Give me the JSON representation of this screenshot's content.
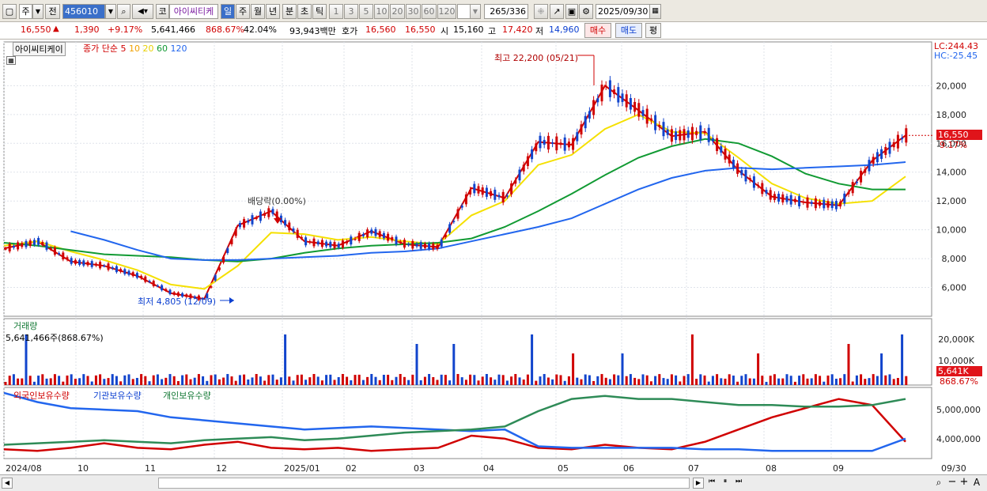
{
  "toolbar": {
    "market": "주",
    "prev_label": "전",
    "code": "456010",
    "name_prefix": "코",
    "name": "아이씨티케",
    "periods": [
      "일",
      "주",
      "월",
      "년",
      "분",
      "초",
      "틱"
    ],
    "period_selected": "일",
    "intervals": [
      "1",
      "3",
      "5",
      "10",
      "20",
      "30",
      "60",
      "120"
    ],
    "count": "265",
    "count_total": "/336",
    "date": "2025/09/30"
  },
  "info": {
    "price": "16,550",
    "change": "1,390",
    "change_pct": "+9.17%",
    "volume": "5,641,466",
    "volume_ratio": "868.67%",
    "turnover": "42.04%",
    "amount": "93,943백만",
    "bid_label": "호가",
    "bid1": "16,560",
    "bid2": "16,550",
    "open_label": "시",
    "open": "15,160",
    "high_label": "고",
    "high": "17,420",
    "low_label": "저",
    "low": "14,960",
    "buy_label": "매수",
    "sell_label": "매도",
    "eval_label": "평"
  },
  "price_panel": {
    "title": "아이씨티케이",
    "legend": "종가 단순",
    "ma": [
      {
        "label": "5",
        "color": "#d00000"
      },
      {
        "label": "10",
        "color": "#f0a000"
      },
      {
        "label": "20",
        "color": "#f5e000"
      },
      {
        "label": "60",
        "color": "#119a33"
      },
      {
        "label": "120",
        "color": "#2266ee"
      }
    ],
    "lc": "LC:244.43",
    "hc": "HC:-25.45",
    "annotations": {
      "high": "최고 22,200 (05/21)",
      "low": "최저 4,805 (12/09)",
      "dividend": "배당락(0.00%)"
    },
    "current_price_tag": "16,550",
    "current_pct_tag": "9.17%"
  },
  "volume_panel": {
    "title": "거래량",
    "value": "5,641,466주(868.67%)",
    "tag1": "5,641K",
    "tag2": "868.67%"
  },
  "holding_panel": {
    "legend": [
      "외국인보유수량",
      "기관보유수량",
      "개인보유수량"
    ]
  },
  "x_axis": [
    "2024/08",
    "10",
    "11",
    "12",
    "2025/01",
    "02",
    "03",
    "04",
    "05",
    "06",
    "07",
    "08",
    "09",
    "09/30"
  ],
  "chart_data": {
    "type": "line",
    "title": "아이씨티케이",
    "y_ticks": [
      6000,
      8000,
      10000,
      12000,
      14000,
      16000,
      18000,
      20000
    ],
    "volume_ticks": [
      "10,000K",
      "20,000K"
    ],
    "holding_ticks": [
      "4,000,000",
      "5,000,000"
    ],
    "x_labels": [
      "2024/08",
      "10",
      "11",
      "12",
      "2025/01",
      "02",
      "03",
      "04",
      "05",
      "06",
      "07",
      "08",
      "09"
    ],
    "series": [
      {
        "name": "5",
        "values": [
          8700,
          9200,
          7800,
          7500,
          6800,
          5600,
          5200,
          10300,
          11300,
          9200,
          8900,
          9900,
          9000,
          8800,
          12900,
          12200,
          16100,
          15900,
          20000,
          18300,
          16500,
          16800,
          14100,
          12300,
          11900,
          11700,
          14800,
          16550
        ]
      },
      {
        "name": "20",
        "values": [
          8900,
          9200,
          8500,
          7900,
          7200,
          6200,
          5900,
          7500,
          9800,
          9700,
          9300,
          9500,
          9200,
          9000,
          11000,
          12000,
          14500,
          15200,
          17000,
          18000,
          16800,
          16700,
          15000,
          13200,
          12200,
          11800,
          12000,
          13700
        ]
      },
      {
        "name": "60",
        "values": [
          9100,
          8900,
          8600,
          8300,
          8200,
          8100,
          7900,
          7800,
          8000,
          8400,
          8700,
          8900,
          9000,
          9100,
          9400,
          10200,
          11300,
          12500,
          13800,
          15000,
          15800,
          16300,
          16000,
          15100,
          13900,
          13200,
          12800,
          12800
        ]
      },
      {
        "name": "120",
        "values": [
          null,
          null,
          9900,
          9300,
          8600,
          8000,
          7900,
          7900,
          8000,
          8100,
          8200,
          8400,
          8500,
          8700,
          9200,
          9700,
          10200,
          10800,
          11800,
          12800,
          13600,
          14100,
          14300,
          14200,
          14300,
          14400,
          14500,
          14700
        ]
      }
    ],
    "holdings": [
      {
        "name": "외국인보유수량",
        "values": [
          3650,
          3600,
          3700,
          3850,
          3700,
          3650,
          3800,
          3900,
          3700,
          3650,
          3700,
          3600,
          3650,
          3700,
          4100,
          4000,
          3700,
          3650,
          3800,
          3700,
          3650,
          3900,
          4300,
          4700,
          5000,
          5300,
          5100,
          3900
        ]
      },
      {
        "name": "기관보유수량",
        "values": [
          5500,
          5200,
          5000,
          4950,
          4900,
          4700,
          4600,
          4500,
          4400,
          4300,
          4350,
          4400,
          4350,
          4300,
          4250,
          4300,
          3750,
          3700,
          3700,
          3700,
          3700,
          3650,
          3650,
          3600,
          3600,
          3600,
          3600,
          4000
        ]
      },
      {
        "name": "개인보유수량",
        "values": [
          3800,
          3850,
          3900,
          3950,
          3900,
          3850,
          3950,
          4000,
          4050,
          3950,
          4000,
          4100,
          4200,
          4250,
          4300,
          4400,
          4900,
          5300,
          5400,
          5300,
          5300,
          5200,
          5100,
          5100,
          5050,
          5050,
          5100,
          5300
        ]
      }
    ]
  }
}
